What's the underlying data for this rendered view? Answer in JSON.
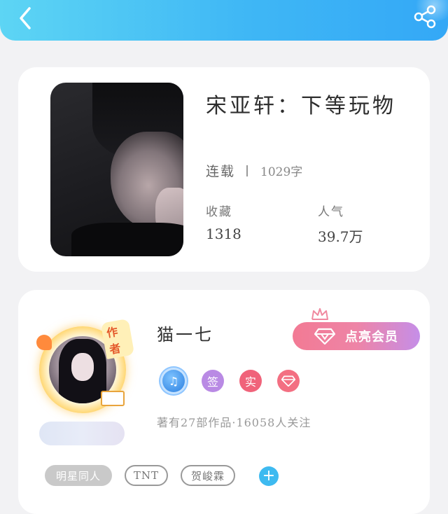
{
  "header": {
    "back_icon": "chevron-left-icon",
    "share_icon": "share-icon",
    "gradient": [
      "#5dd5f4",
      "#34a8f6"
    ]
  },
  "book": {
    "title": "宋亚轩：下等玩物",
    "status": "连载",
    "word_count": "1029字",
    "favorites_label": "收藏",
    "favorites_value": "1318",
    "popularity_label": "人气",
    "popularity_value": "39.7万"
  },
  "author": {
    "tag": "作者",
    "name": "猫一七",
    "vip_button_label": "点亮会员",
    "badges": [
      {
        "icon": "music-note-badge-icon",
        "text": "♫",
        "color": "#2b7fe0"
      },
      {
        "icon": "sign-badge-icon",
        "text": "签",
        "color": "#b98ae4"
      },
      {
        "icon": "real-name-badge-icon",
        "text": "实",
        "color": "#f0637a"
      },
      {
        "icon": "diamond-badge-icon",
        "text": "",
        "color": "#f36f82"
      }
    ],
    "works_info": "著有27部作品·16058人关注",
    "tags": [
      "明星同人",
      "TNT",
      "贺峻霖"
    ],
    "add_tag_label": "+"
  },
  "colors": {
    "accent_blue": "#3ebaf0",
    "vip_gradient_start": "#f27a94",
    "vip_gradient_end": "#c58ee8"
  }
}
